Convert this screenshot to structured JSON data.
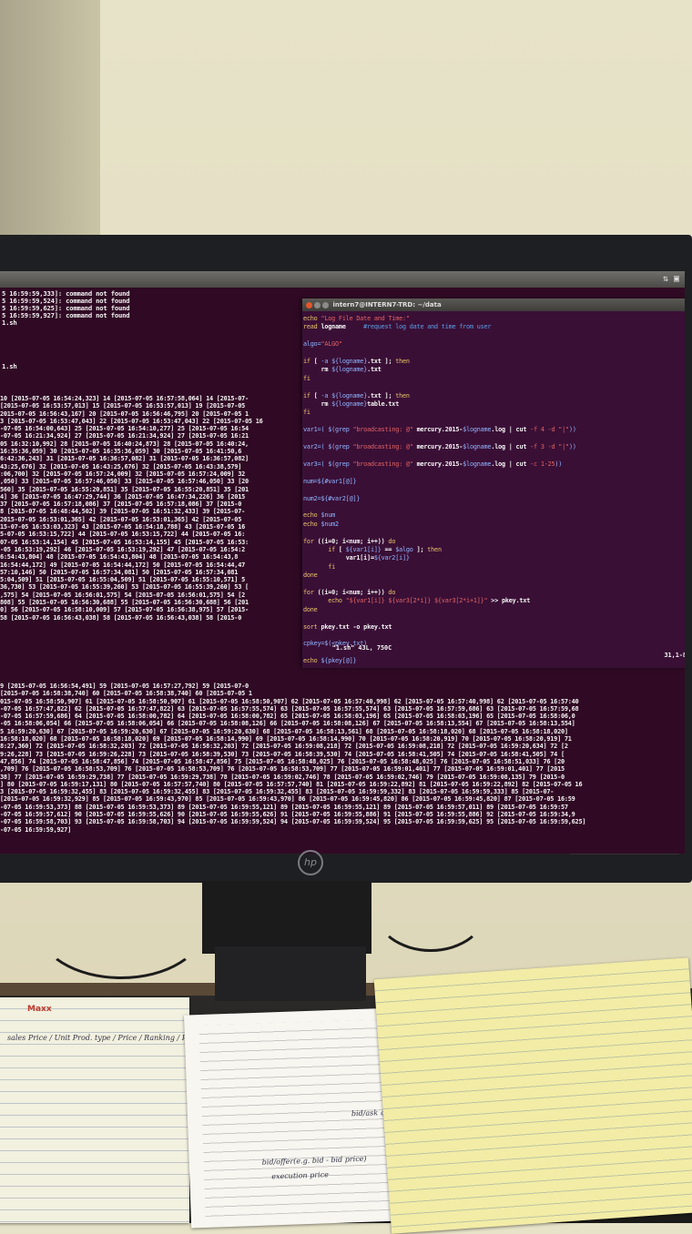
{
  "screen_top": {
    "errors": [
      "5 16:59:59,333]: command not found",
      "5 16:59:59,524]: command not found",
      "5 16:59:59,625]: command not found",
      "5 16:59:59,927]: command not found"
    ],
    "prompt_1": "1.sh",
    "prompt_2": "1.sh"
  },
  "log_lines": [
    "10 [2015-07-05 16:54:24,323] 14 [2015-07-05 16:57:58,064] 14 [2015-07-",
    "[2015-07-05 16:53:57,013] 15 [2015-07-05 16:53:57,013] 19 [2015-07-05",
    "2015-07-05 16:56:43,167] 20 [2015-07-05 16:56:46,795] 20 [2015-07-05 1",
    "3 [2015-07-05 16:53:47,043] 22 [2015-07-05 16:53:47,043] 22 [2015-07-05 16",
    "-07-05 16:54:00,643] 25 [2015-07-05 16:54:10,277] 25 [2015-07-05 16:54",
    "-07-05 16:21:34,924] 27 [2015-07-05 16:21:34,924] 27 [2015-07-05 16:21",
    "05 16:32:10,992] 28 [2015-07-05 16:40:24,873] 28 [2015-07-05 16:40:24,",
    "16:35:36,059] 30 [2015-07-05 16:35:36,059] 30 [2015-07-05 16:41:50,6",
    "6:42:36,243] 31 [2015-07-05 16:36:57,082] 31 [2015-07-05 16:36:57,082]",
    "43:25,676] 32 [2015-07-05 16:43:25,676] 32 [2015-07-05 16:43:38,579]",
    ":06,700] 32 [2015-07-05 16:57:24,009] 32 [2015-07-05 16:57:24,009] 32",
    ",050] 33 [2015-07-05 16:57:46,050] 33 [2015-07-05 16:57:46,050] 33 [20",
    "560] 35 [2015-07-05 16:55:20,851] 35 [2015-07-05 16:55:20,851] 35 [201",
    "4] 36 [2015-07-05 16:47:29,744] 36 [2015-07-05 16:47:34,226] 36 [2015",
    " 37 [2015-07-05 16:57:18,086] 37 [2015-07-05 16:57:18,086] 37 [2015-0",
    "8 [2015-07-05 16:48:44,502] 39 [2015-07-05 16:51:32,433] 39 [2015-07-",
    "2015-07-05 16:53:01,365] 42 [2015-07-05 16:53:01,365] 42 [2015-07-05",
    "15-07-05 16:53:03,323] 43 [2015-07-05 16:54:18,788] 43 [2015-07-05 16",
    "5-07-05 16:53:15,722] 44 [2015-07-05 16:53:15,722] 44 [2015-07-05 16:",
    "07-05 16:53:14,154] 45 [2015-07-05 16:53:14,155] 45 [2015-07-05 16:53:",
    "-05 16:53:19,292] 46 [2015-07-05 16:53:19,292] 47 [2015-07-05 16:54:2",
    "6:54:43,804] 48 [2015-07-05 16:54:43,804] 48 [2015-07-05 16:54:43,8",
    "16:54:44,172] 49 [2015-07-05 16:54:44,172] 50 [2015-07-05 16:54:44,47",
    "57:10,146] 50 [2015-07-05 16:57:34,081] 50 [2015-07-05 16:57:34,081",
    "5:04,509] 51 [2015-07-05 16:55:04,509] 51 [2015-07-05 16:55:10,571] 5",
    "36,730] 53 [2015-07-05 16:55:39,260] 53 [2015-07-05 16:55:39,260] 53 [",
    ",575] 54 [2015-07-05 16:56:01,575] 54 [2015-07-05 16:56:01,575] 54 [2",
    "808] 55 [2015-07-05 16:56:30,688] 55 [2015-07-05 16:56:30,688] 56 [201",
    "0] 56 [2015-07-05 16:58:10,009] 57 [2015-07-05 16:56:38,975] 57 [2015-",
    " 58 [2015-07-05 16:56:43,038] 58 [2015-07-05 16:56:43,038] 58 [2015-0"
  ],
  "bottom_lines": [
    "9 [2015-07-05 16:56:54,491] 59 [2015-07-05 16:57:27,792] 59 [2015-07-0",
    "[2015-07-05 16:58:38,740] 60 [2015-07-05 16:58:38,740] 60 [2015-07-05 1",
    "015-07-05 16:58:50,907] 61 [2015-07-05 16:58:50,907] 61 [2015-07-05 16:58:50,907] 62 [2015-07-05 16:57:40,998] 62 [2015-07-05 16:57:40,998] 62 [2015-07-05 16:57:40",
    "-07-05 16:57:47,822] 62 [2015-07-05 16:57:47,822] 63 [2015-07-05 16:57:55,574] 63 [2015-07-05 16:57:55,574] 63 [2015-07-05 16:57:59,686] 63 [2015-07-05 16:57:59,68",
    "-07-05 16:57:59,686] 64 [2015-07-05 16:58:00,782] 64 [2015-07-05 16:58:00,782] 65 [2015-07-05 16:58:03,196] 65 [2015-07-05 16:58:03,196] 65 [2015-07-05 16:58:06,0",
    "-05 16:58:06,054] 66 [2015-07-05 16:58:06,054] 66 [2015-07-05 16:58:08,126] 66 [2015-07-05 16:58:08,126] 67 [2015-07-05 16:58:13,554] 67 [2015-07-05 16:58:13,554]",
    "5 16:59:20,630] 67 [2015-07-05 16:59:20,630] 67 [2015-07-05 16:59:20,630] 68 [2015-07-05 16:58:13,561] 68 [2015-07-05 16:58:18,020] 68 [2015-07-05 16:58:18,020]",
    "16:58:18,020] 68 [2015-07-05 16:58:18,020] 69 [2015-07-05 16:58:14,990] 69 [2015-07-05 16:58:14,990] 70 [2015-07-05 16:58:20,919] 70 [2015-07-05 16:58:20,919] 71",
    "8:27,360] 72 [2015-07-05 16:58:32,203] 72 [2015-07-05 16:58:32,203] 72 [2015-07-05 16:59:08,218] 72 [2015-07-05 16:59:08,218] 72 [2015-07-05 16:59:20,634] 72 [2",
    "9:26,228] 73 [2015-07-05 16:59:26,228] 73 [2015-07-05 16:58:39,530] 73 [2015-07-05 16:58:39,530] 74 [2015-07-05 16:58:41,505] 74 [2015-07-05 16:58:41,505] 74 [",
    "47,856] 74 [2015-07-05 16:58:47,856] 74 [2015-07-05 16:58:47,856] 75 [2015-07-05 16:58:48,025] 76 [2015-07-05 16:58:48,025] 76 [2015-07-05 16:58:51,033] 76 [20",
    ",709] 76 [2015-07-05 16:58:53,709] 76 [2015-07-05 16:58:53,709] 76 [2015-07-05 16:58:53,709] 77 [2015-07-05 16:59:01,401] 77 [2015-07-05 16:59:01,401] 77 [2015",
    "38] 77 [2015-07-05 16:59:29,738] 77 [2015-07-05 16:59:29,738] 78 [2015-07-05 16:59:02,746] 78 [2015-07-05 16:59:02,746] 79 [2015-07-05 16:59:08,135] 79 [2015-0",
    "] 80 [2015-07-05 16:59:17,131] 80 [2015-07-05 16:57:57,740] 80 [2015-07-05 16:57:57,740] 81 [2015-07-05 16:59:22,892] 81 [2015-07-05 16:59:22,892] 82 [2015-07-05 16",
    "3 [2015-07-05 16:59:32,455] 83 [2015-07-05 16:59:32,455] 83 [2015-07-05 16:59:32,455] 83 [2015-07-05 16:59:59,332] 83 [2015-07-05 16:59:59,333] 85 [2015-07-",
    "[2015-07-05 16:59:32,929] 85 [2015-07-05 16:59:43,970] 85 [2015-07-05 16:59:43,970] 86 [2015-07-05 16:59:45,820] 86 [2015-07-05 16:59:45,820] 87 [2015-07-05 16:59",
    "-07-05 16:59:53,373] 88 [2015-07-05 16:59:53,373] 89 [2015-07-05 16:59:55,121] 89 [2015-07-05 16:59:55,121] 89 [2015-07-05 16:59:57,011] 89 [2015-07-05 16:59:57",
    "-07-05 16:59:57,612] 90 [2015-07-05 16:59:55,626] 90 [2015-07-05 16:59:55,626] 91 [2015-07-05 16:59:55,886] 91 [2015-07-05 16:59:55,886] 92 [2015-07-05 16:59:34,9",
    "-07-05 16:59:58,703] 93 [2015-07-05 16:59:58,703] 94 [2015-07-05 16:59:59,524] 94 [2015-07-05 16:59:59,524] 95 [2015-07-05 16:59:59,625] 95 [2015-07-05 16:59:59,625]",
    "-07-05 16:59:59,927]"
  ],
  "vim": {
    "title": "intern7@INTERN7-TRD: ~/data",
    "status_file": "\"1.sh\" 43L, 750C",
    "status_pos": "31,1-8",
    "code": [
      [
        {
          "c": "kw",
          "t": "echo "
        },
        {
          "c": "str",
          "t": "\"Log File Date and Time:\""
        }
      ],
      [
        {
          "c": "kw",
          "t": "read "
        },
        {
          "c": "pl",
          "t": "logname"
        },
        {
          "c": "cm",
          "t": "     #request log date and time from user"
        }
      ],
      [],
      [
        {
          "c": "var",
          "t": "algo="
        },
        {
          "c": "str",
          "t": "\"ALGO\""
        }
      ],
      [],
      [
        {
          "c": "kw",
          "t": "if "
        },
        {
          "c": "pl",
          "t": "[ "
        },
        {
          "c": "var",
          "t": "-a ${logname}"
        },
        {
          "c": "pl",
          "t": ".txt ]; "
        },
        {
          "c": "kw",
          "t": "then"
        }
      ],
      [
        {
          "c": "pl",
          "t": "     rm "
        },
        {
          "c": "var",
          "t": "${logname}"
        },
        {
          "c": "pl",
          "t": ".txt"
        }
      ],
      [
        {
          "c": "kw",
          "t": "fi"
        }
      ],
      [],
      [
        {
          "c": "kw",
          "t": "if "
        },
        {
          "c": "pl",
          "t": "[ "
        },
        {
          "c": "var",
          "t": "-a ${logname}"
        },
        {
          "c": "pl",
          "t": ".txt ]; "
        },
        {
          "c": "kw",
          "t": "then"
        }
      ],
      [
        {
          "c": "pl",
          "t": "     rm "
        },
        {
          "c": "var",
          "t": "${logname}"
        },
        {
          "c": "pl",
          "t": "table.txt"
        }
      ],
      [
        {
          "c": "kw",
          "t": "fi"
        }
      ],
      [],
      [
        {
          "c": "var",
          "t": "var1=( $(grep "
        },
        {
          "c": "str",
          "t": "\"broadcasting: @\""
        },
        {
          "c": "pl",
          "t": " mercury.2015-"
        },
        {
          "c": "var",
          "t": "$logname"
        },
        {
          "c": "pl",
          "t": ".log | cut "
        },
        {
          "c": "str",
          "t": "-f 4 -d \"|\""
        },
        {
          "c": "var",
          "t": "))"
        }
      ],
      [],
      [
        {
          "c": "var",
          "t": "var2=( $(grep "
        },
        {
          "c": "str",
          "t": "\"broadcasting: @\""
        },
        {
          "c": "pl",
          "t": " mercury.2015-"
        },
        {
          "c": "var",
          "t": "$logname"
        },
        {
          "c": "pl",
          "t": ".log | cut "
        },
        {
          "c": "str",
          "t": "-f 3 -d \"|\""
        },
        {
          "c": "var",
          "t": "))"
        }
      ],
      [],
      [
        {
          "c": "var",
          "t": "var3=( $(grep "
        },
        {
          "c": "str",
          "t": "\"broadcasting: @\""
        },
        {
          "c": "pl",
          "t": " mercury.2015-"
        },
        {
          "c": "var",
          "t": "$logname"
        },
        {
          "c": "pl",
          "t": ".log | cut "
        },
        {
          "c": "str",
          "t": "-c 1-25"
        },
        {
          "c": "var",
          "t": "))"
        }
      ],
      [],
      [
        {
          "c": "var",
          "t": "num=${#var1[@]}"
        }
      ],
      [],
      [
        {
          "c": "var",
          "t": "num2=${#var2[@]}"
        }
      ],
      [],
      [
        {
          "c": "kw",
          "t": "echo "
        },
        {
          "c": "var",
          "t": "$num"
        }
      ],
      [
        {
          "c": "kw",
          "t": "echo "
        },
        {
          "c": "var",
          "t": "$num2"
        }
      ],
      [],
      [
        {
          "c": "kw",
          "t": "for "
        },
        {
          "c": "pl",
          "t": "((i=0; i<num; i++)) "
        },
        {
          "c": "kw",
          "t": "do"
        }
      ],
      [
        {
          "c": "kw",
          "t": "       if "
        },
        {
          "c": "pl",
          "t": "[ "
        },
        {
          "c": "var",
          "t": "${var1[i]}"
        },
        {
          "c": "pl",
          "t": " == "
        },
        {
          "c": "var",
          "t": "$algo"
        },
        {
          "c": "pl",
          "t": " ]; "
        },
        {
          "c": "kw",
          "t": "then"
        }
      ],
      [
        {
          "c": "pl",
          "t": "            var1[i]="
        },
        {
          "c": "var",
          "t": "${var2[i]}"
        }
      ],
      [
        {
          "c": "kw",
          "t": "       fi"
        }
      ],
      [
        {
          "c": "kw",
          "t": "done"
        }
      ],
      [],
      [
        {
          "c": "kw",
          "t": "for "
        },
        {
          "c": "pl",
          "t": "((i=0; i<num; i++)) "
        },
        {
          "c": "kw",
          "t": "do"
        }
      ],
      [
        {
          "c": "kw",
          "t": "       echo "
        },
        {
          "c": "str",
          "t": "\"${var1[i]} ${var3[2*i]} ${var3[2*i+1]}\""
        },
        {
          "c": "pl",
          "t": " >> pkey.txt"
        }
      ],
      [
        {
          "c": "kw",
          "t": "done"
        }
      ],
      [],
      [
        {
          "c": "kw",
          "t": "sort "
        },
        {
          "c": "pl",
          "t": "pkey.txt -o pkey.txt"
        }
      ],
      [],
      [
        {
          "c": "var",
          "t": "cpkey=$(<pkey.txt)"
        }
      ],
      [],
      [
        {
          "c": "kw",
          "t": "echo "
        },
        {
          "c": "var",
          "t": "${pkey[@]}"
        }
      ]
    ]
  },
  "monitor": {
    "logo": "hp"
  },
  "desk": {
    "stamp": "Maxx",
    "note_left": "sales  Price / Unit  Prod. type / Price / Ranking / Product",
    "note_mid": "bid/offer(e.g. bid - bid price)",
    "note_mid_2": "execution price",
    "note_mid_3": "bid/ask quantity +"
  }
}
